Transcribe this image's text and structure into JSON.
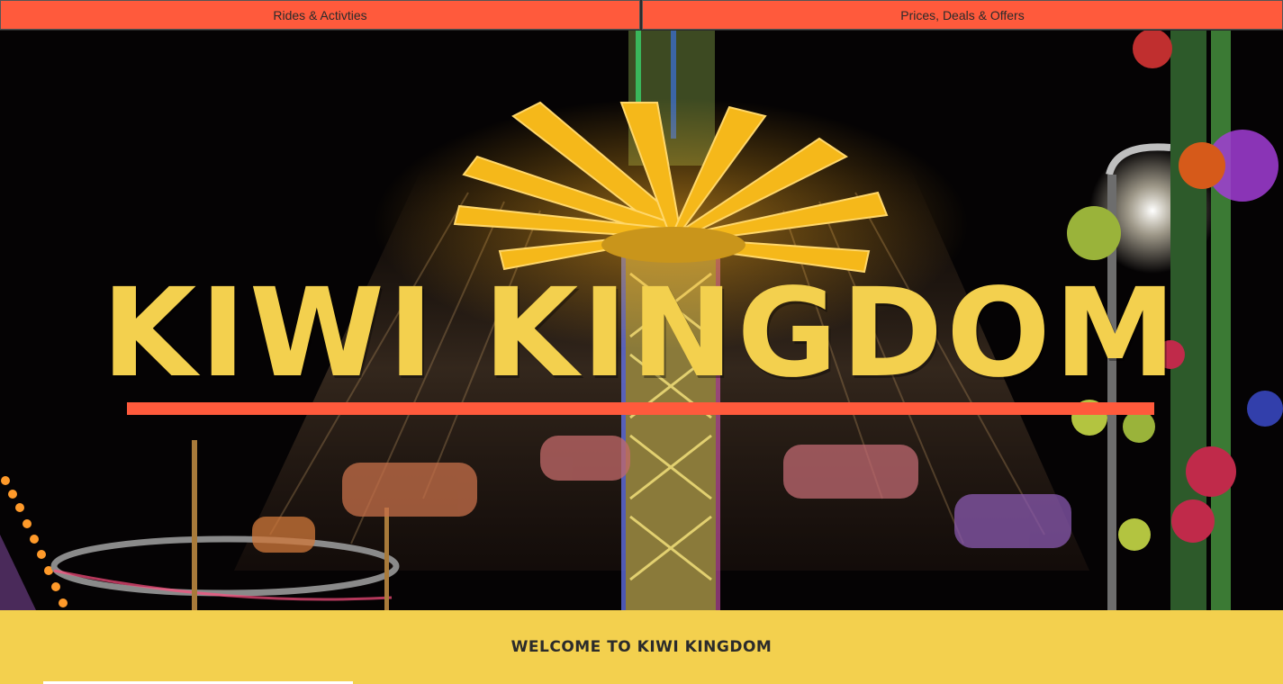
{
  "nav": {
    "rides_label": "Rides & Activties",
    "prices_label": "Prices, Deals & Offers"
  },
  "hero": {
    "title": "KIWI KINGDOM",
    "image_subject": "spinning swing carousel ride at night with yellow lights"
  },
  "welcome": {
    "text": "WELCOME TO KIWI KINGDOM"
  },
  "colors": {
    "accent_red": "#ff5a3c",
    "accent_yellow": "#f3d04e",
    "text_dark": "#2b2b2b"
  }
}
